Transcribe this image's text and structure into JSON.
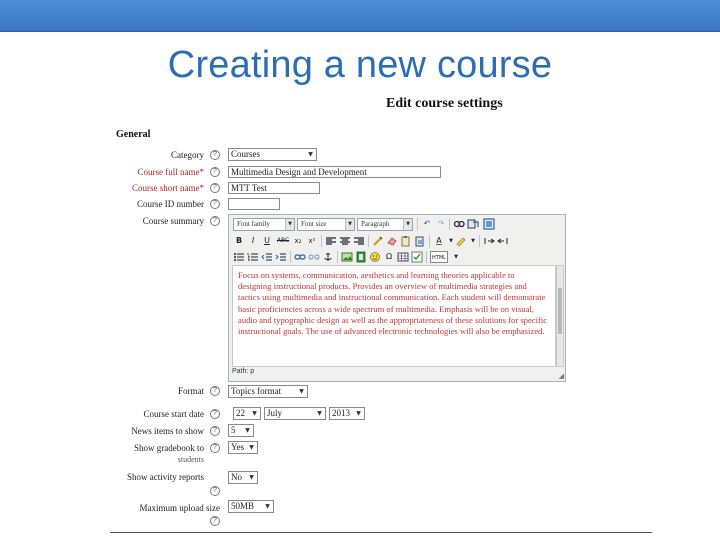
{
  "slide": {
    "title": "Creating a new course"
  },
  "form": {
    "heading": "Edit course settings",
    "section": "General",
    "category": {
      "label": "Category",
      "value": "Courses"
    },
    "fullname": {
      "label": "Course full name*",
      "value": "Multimedia Design and Development"
    },
    "shortname": {
      "label": "Course short name*",
      "value": "MTT Test"
    },
    "idnumber": {
      "label": "Course ID number",
      "value": ""
    },
    "summary": {
      "label": "Course summary",
      "toolbar": {
        "font_family": "Font family",
        "font_size": "Font size",
        "format": "Paragraph"
      },
      "text": "Focus on systems, communication, aesthetics and learning theories applicable to designing instructional products. Provides an overview of multimedia strategies and tactics using multimedia and instructional communication. Each student will demonstrate basic proficiencies across a wide spectrum of multimedia. Emphasis will be on visual, audio and typographic design as well as the appropriateness of these solutions for specific instructional goals. The use of advanced electronic technologies will also be emphasized.",
      "path": "Path: p"
    },
    "format": {
      "label": "Format",
      "value": "Topics format"
    },
    "startdate": {
      "label": "Course start date",
      "day": "22",
      "month": "July",
      "year": "2013"
    },
    "newsitems": {
      "label": "News items to show",
      "value": "5"
    },
    "gradebook": {
      "label": "Show gradebook to",
      "sublabel": "students",
      "value": "Yes"
    },
    "activity": {
      "label": "Show activity reports",
      "value": "No"
    },
    "upload": {
      "label": "Maximum upload size",
      "value": "50MB"
    }
  },
  "icons": {
    "help": "?",
    "dropdown": "▼",
    "bold": "B",
    "italic": "I",
    "underline": "U",
    "strike": "ABC",
    "sub": "x₂",
    "sup": "x²",
    "undo": "↶",
    "redo": "↷",
    "omega": "Ω",
    "html": "HTML",
    "grip": "◢"
  }
}
